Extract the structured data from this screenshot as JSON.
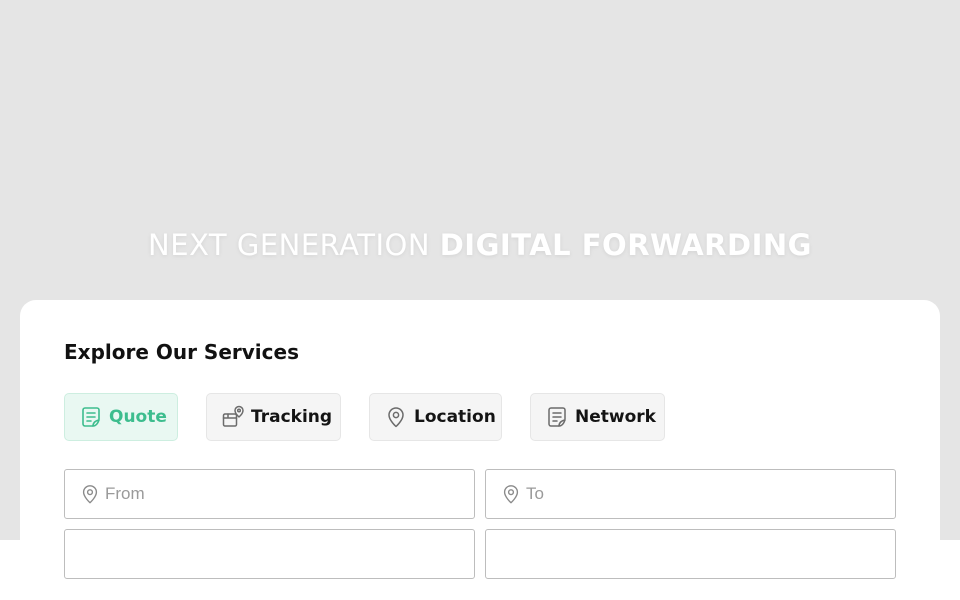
{
  "hero": {
    "title_light": "NEXT GENERATION ",
    "title_bold": "DIGITAL FORWARDING",
    "background_color": "#e5e5e5"
  },
  "services": {
    "title": "Explore Our Services",
    "accent_color": "#3dbd8e",
    "tabs": [
      {
        "label": "Quote",
        "icon": "quote-document-icon",
        "active": true
      },
      {
        "label": "Tracking",
        "icon": "tracking-box-pin-icon",
        "active": false
      },
      {
        "label": "Location",
        "icon": "location-pin-icon",
        "active": false
      },
      {
        "label": "Network",
        "icon": "network-document-icon",
        "active": false
      }
    ],
    "form": {
      "from_placeholder": "From",
      "to_placeholder": "To",
      "from_value": "",
      "to_value": ""
    }
  }
}
